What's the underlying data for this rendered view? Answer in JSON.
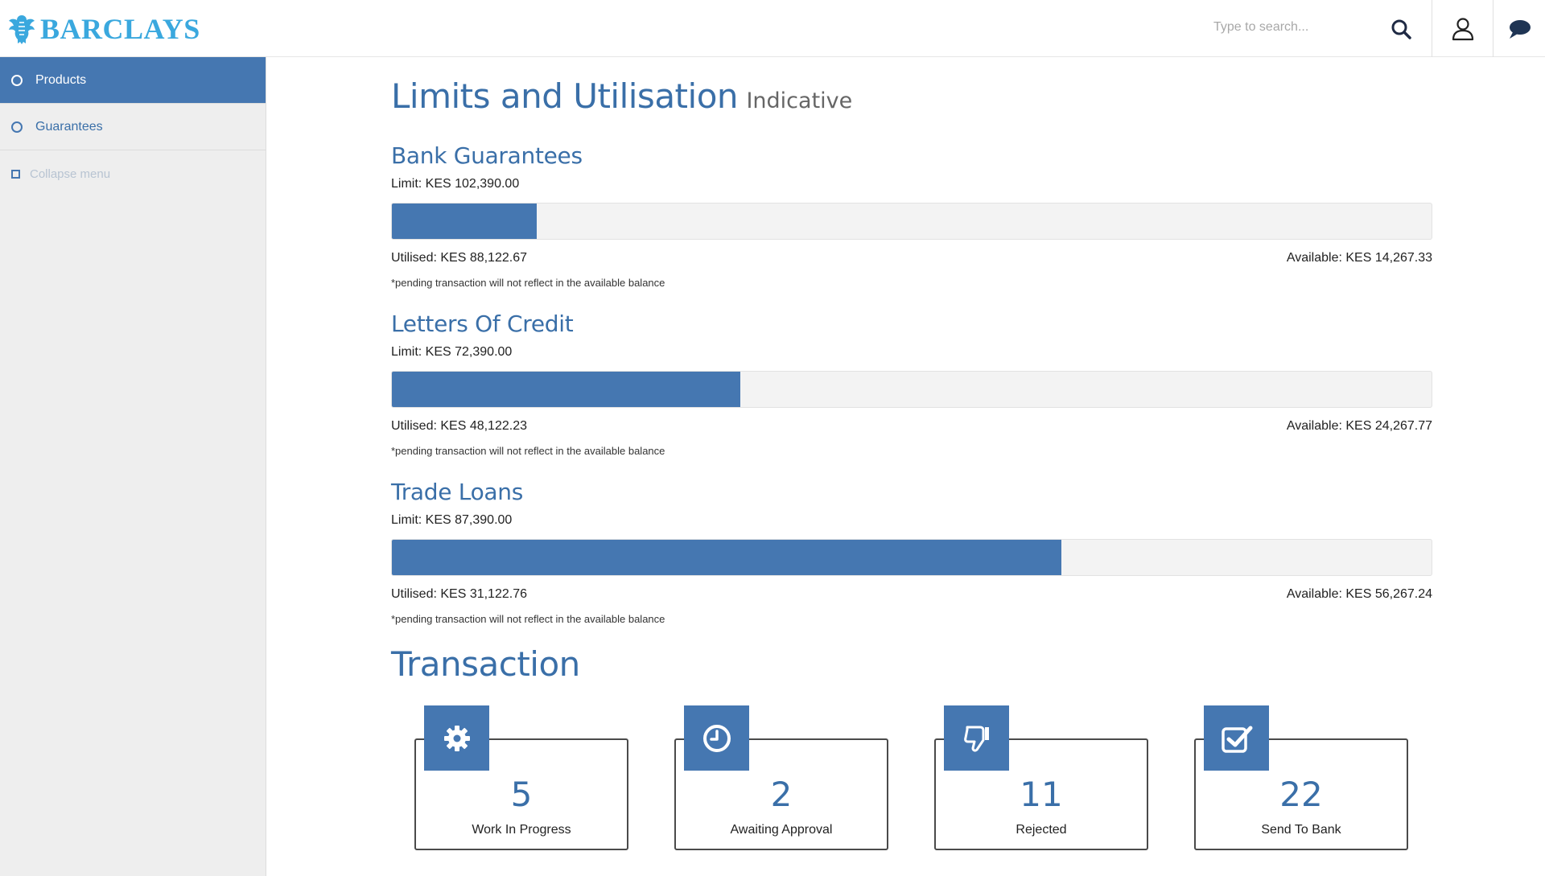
{
  "header": {
    "logo_text": "BARCLAYS",
    "search_placeholder": "Type to search...",
    "icons": [
      "search-icon",
      "user-icon",
      "chat-icon"
    ]
  },
  "sidebar": {
    "items": [
      {
        "label": "Products",
        "active": true
      },
      {
        "label": "Guarantees",
        "active": false
      }
    ],
    "collapse_label": "Collapse menu"
  },
  "main": {
    "title": "Limits and Utilisation",
    "subtitle": "Indicative",
    "limits": [
      {
        "name": "Bank Guarantees",
        "limit": "Limit: KES 102,390.00",
        "utilised": "Utilised: KES 88,122.67",
        "available": "Available: KES 14,267.33",
        "note": "*pending transaction will not reflect in the available balance",
        "fill_fraction": 0.139
      },
      {
        "name": "Letters Of Credit",
        "limit": "Limit: KES 72,390.00",
        "utilised": "Utilised: KES 48,122.23",
        "available": "Available: KES 24,267.77",
        "note": "*pending transaction will not reflect in the available balance",
        "fill_fraction": 0.335
      },
      {
        "name": "Trade Loans",
        "limit": "Limit: KES 87,390.00",
        "utilised": "Utilised: KES 31,122.76",
        "available": "Available: KES 56,267.24",
        "note": "*pending transaction will not reflect in the available balance",
        "fill_fraction": 0.644
      }
    ],
    "transaction_title": "Transaction",
    "transactions": [
      {
        "count": "5",
        "label": "Work In Progress",
        "icon": "gear-icon"
      },
      {
        "count": "2",
        "label": "Awaiting Approval",
        "icon": "clock-icon"
      },
      {
        "count": "11",
        "label": "Rejected",
        "icon": "thumbs-down-icon"
      },
      {
        "count": "22",
        "label": "Send To Bank",
        "icon": "checkbox-icon"
      }
    ]
  },
  "colors": {
    "brand_blue": "#4577b1",
    "logo_blue": "#3aa8de",
    "title_blue": "#3a6fa8"
  }
}
